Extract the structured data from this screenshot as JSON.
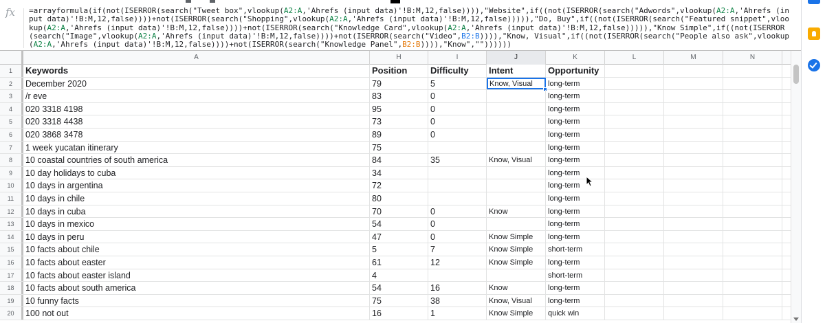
{
  "formula": {
    "fx_symbol": "fx",
    "parts": [
      {
        "t": "=arrayformula(if(not(ISERROR(search(\"Tweet box\",vlookup(",
        "c": ""
      },
      {
        "t": "A2:A",
        "c": "ref-green"
      },
      {
        "t": ",'Ahrefs (input data)'!B:M,12,false)))),\"Website\",if((not(ISERROR(search(\"Adwords\",vlookup(",
        "c": ""
      },
      {
        "t": "A2:A",
        "c": "ref-green"
      },
      {
        "t": ",'Ahrefs (input data)'!B:M,12,false))))+not(ISERROR(search(\"Shopping\",vlookup(",
        "c": ""
      },
      {
        "t": "A2:A",
        "c": "ref-green"
      },
      {
        "t": ",'Ahrefs (input data)'!B:M,12,false))))),\"Do, Buy\",if((not(ISERROR(search(\"Featured snippet\",vlookup(",
        "c": ""
      },
      {
        "t": "A2:A",
        "c": "ref-green"
      },
      {
        "t": ",'Ahrefs (input data)'!B:M,12,false))))+not(ISERROR(search(\"Knowledge Card\",vlookup(",
        "c": ""
      },
      {
        "t": "A2:A",
        "c": "ref-green"
      },
      {
        "t": ",'Ahrefs (input data)'!B:M,12,false))))),\"Know Simple\",if((not(ISERROR(search(\"Image\",vlookup(",
        "c": ""
      },
      {
        "t": "A2:A",
        "c": "ref-green"
      },
      {
        "t": ",'Ahrefs (input data)'!B:M,12,false))))+not(ISERROR(search(\"Video\",",
        "c": ""
      },
      {
        "t": "B2:B",
        "c": "ref-blue"
      },
      {
        "t": ")))),\"Know, Visual\",if((not(ISERROR(search(\"People also ask\",vlookup(",
        "c": ""
      },
      {
        "t": "A2:A",
        "c": "ref-green"
      },
      {
        "t": ",'Ahrefs (input data)'!B:M,12,false))))+not(ISERROR(search(\"Knowledge Panel\",",
        "c": ""
      },
      {
        "t": "B2:B",
        "c": "ref-orange"
      },
      {
        "t": ")))),\"Know\",\"\"))))))",
        "c": ""
      }
    ]
  },
  "columns": [
    {
      "letter": "A",
      "selected": false
    },
    {
      "letter": "H",
      "selected": false
    },
    {
      "letter": "I",
      "selected": false
    },
    {
      "letter": "J",
      "selected": true
    },
    {
      "letter": "K",
      "selected": false
    },
    {
      "letter": "L",
      "selected": false
    },
    {
      "letter": "M",
      "selected": false
    },
    {
      "letter": "N",
      "selected": false
    }
  ],
  "rows": [
    {
      "n": "1",
      "cells": [
        "Keywords",
        "Position",
        "Difficulty",
        "Intent",
        "Opportunity",
        "",
        "",
        ""
      ],
      "header": true
    },
    {
      "n": "2",
      "cells": [
        "December 2020",
        "79",
        "5",
        "Know, Visual",
        "long-term",
        "",
        "",
        ""
      ]
    },
    {
      "n": "3",
      "cells": [
        "/r eve",
        "83",
        "0",
        "",
        "long-term",
        "",
        "",
        ""
      ]
    },
    {
      "n": "4",
      "cells": [
        "020 3318 4198",
        "95",
        "0",
        "",
        "long-term",
        "",
        "",
        ""
      ]
    },
    {
      "n": "5",
      "cells": [
        "020 3318 4438",
        "73",
        "0",
        "",
        "long-term",
        "",
        "",
        ""
      ]
    },
    {
      "n": "6",
      "cells": [
        "020 3868 3478",
        "89",
        "0",
        "",
        "long-term",
        "",
        "",
        ""
      ]
    },
    {
      "n": "7",
      "cells": [
        "1 week yucatan itinerary",
        "75",
        "",
        "",
        "long-term",
        "",
        "",
        ""
      ]
    },
    {
      "n": "8",
      "cells": [
        "10 coastal countries of south america",
        "84",
        "35",
        "Know, Visual",
        "long-term",
        "",
        "",
        ""
      ]
    },
    {
      "n": "9",
      "cells": [
        "10 day holidays to cuba",
        "34",
        "",
        "",
        "long-term",
        "",
        "",
        ""
      ]
    },
    {
      "n": "10",
      "cells": [
        "10 days in argentina",
        "72",
        "",
        "",
        "long-term",
        "",
        "",
        ""
      ]
    },
    {
      "n": "11",
      "cells": [
        "10 days in chile",
        "80",
        "",
        "",
        "long-term",
        "",
        "",
        ""
      ]
    },
    {
      "n": "12",
      "cells": [
        "10 days in cuba",
        "70",
        "0",
        "Know",
        "long-term",
        "",
        "",
        ""
      ]
    },
    {
      "n": "13",
      "cells": [
        "10 days in mexico",
        "54",
        "0",
        "",
        "long-term",
        "",
        "",
        ""
      ]
    },
    {
      "n": "14",
      "cells": [
        "10 days in peru",
        "47",
        "0",
        "Know Simple",
        "long-term",
        "",
        "",
        ""
      ]
    },
    {
      "n": "15",
      "cells": [
        "10 facts about chile",
        "5",
        "7",
        "Know Simple",
        "short-term",
        "",
        "",
        ""
      ]
    },
    {
      "n": "16",
      "cells": [
        "10 facts about easter",
        "61",
        "12",
        "Know Simple",
        "long-term",
        "",
        "",
        ""
      ]
    },
    {
      "n": "17",
      "cells": [
        "10 facts about easter island",
        "4",
        "",
        "",
        "short-term",
        "",
        "",
        ""
      ]
    },
    {
      "n": "18",
      "cells": [
        "10 facts about south america",
        "54",
        "16",
        "Know",
        "long-term",
        "",
        "",
        ""
      ]
    },
    {
      "n": "19",
      "cells": [
        "10 funny facts",
        "75",
        "38",
        "Know, Visual",
        "long-term",
        "",
        "",
        ""
      ]
    },
    {
      "n": "20",
      "cells": [
        "100 not out",
        "16",
        "1",
        "Know Simple",
        "quick win",
        "",
        "",
        ""
      ]
    }
  ],
  "active_cell": {
    "row": 1,
    "col": 3
  },
  "colors": {
    "accent": "#1a73e8",
    "grid_line": "#e2e3e3",
    "header_bg": "#f8f9fa"
  },
  "side_panel": {
    "icons": [
      "calendar-icon",
      "keep-icon",
      "tasks-icon"
    ]
  }
}
